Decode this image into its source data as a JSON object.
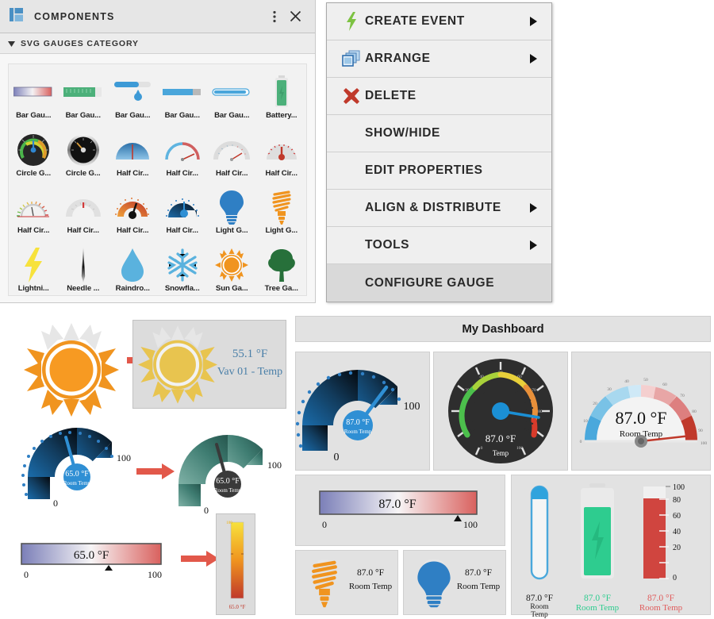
{
  "components_panel": {
    "title": "COMPONENTS",
    "icons": {
      "panel": "panel-grid-icon",
      "kebab": "more-options-icon",
      "close": "close-icon",
      "caret": "caret-down-icon"
    },
    "category": "SVG GAUGES CATEGORY",
    "items": [
      {
        "label": "Bar Gau...",
        "icon": "bar-gauge-gradient-icon"
      },
      {
        "label": "Bar Gau...",
        "icon": "bar-gauge-green-ticks-icon"
      },
      {
        "label": "Bar Gau...",
        "icon": "bar-gauge-slider-drop-icon"
      },
      {
        "label": "Bar Gau...",
        "icon": "bar-gauge-blue-fill-icon"
      },
      {
        "label": "Bar Gau...",
        "icon": "bar-gauge-rounded-icon"
      },
      {
        "label": "Battery...",
        "icon": "battery-gauge-icon"
      },
      {
        "label": "Circle G...",
        "icon": "circle-gauge-dark-icon"
      },
      {
        "label": "Circle G...",
        "icon": "circle-gauge-chrome-icon"
      },
      {
        "label": "Half Cir...",
        "icon": "half-circle-blue-dome-icon"
      },
      {
        "label": "Half Cir...",
        "icon": "half-circle-blue-red-icon"
      },
      {
        "label": "Half Cir...",
        "icon": "half-circle-grey-ticks-icon"
      },
      {
        "label": "Half Cir...",
        "icon": "half-circle-red-needle-icon"
      },
      {
        "label": "Half Cir...",
        "icon": "half-circle-color-ticks-icon"
      },
      {
        "label": "Half Cir...",
        "icon": "half-circle-grey-small-icon"
      },
      {
        "label": "Half Cir...",
        "icon": "half-circle-orange-black-icon"
      },
      {
        "label": "Half Cir...",
        "icon": "half-circle-navy-dotted-icon"
      },
      {
        "label": "Light G...",
        "icon": "light-bulb-gauge-icon"
      },
      {
        "label": "Light G...",
        "icon": "cfl-bulb-gauge-icon"
      },
      {
        "label": "Lightni...",
        "icon": "lightning-gauge-icon"
      },
      {
        "label": "Needle ...",
        "icon": "needle-gauge-icon"
      },
      {
        "label": "Raindro...",
        "icon": "raindrop-gauge-icon"
      },
      {
        "label": "Snowfla...",
        "icon": "snowflake-gauge-icon"
      },
      {
        "label": "Sun Ga...",
        "icon": "sun-gauge-icon"
      },
      {
        "label": "Tree Ga...",
        "icon": "tree-gauge-icon"
      }
    ]
  },
  "context_menu": {
    "items": [
      {
        "label": "CREATE EVENT",
        "icon": "lightning-bolt-icon",
        "submenu": true,
        "highlight": false
      },
      {
        "label": "ARRANGE",
        "icon": "arrange-windows-icon",
        "submenu": true,
        "highlight": false
      },
      {
        "label": "DELETE",
        "icon": "delete-x-icon",
        "submenu": false,
        "highlight": false
      },
      {
        "label": "SHOW/HIDE",
        "icon": "",
        "submenu": false,
        "highlight": false
      },
      {
        "label": "EDIT PROPERTIES",
        "icon": "",
        "submenu": false,
        "highlight": false
      },
      {
        "label": "ALIGN & DISTRIBUTE",
        "icon": "",
        "submenu": true,
        "highlight": false
      },
      {
        "label": "TOOLS",
        "icon": "",
        "submenu": true,
        "highlight": false
      },
      {
        "label": "CONFIGURE GAUGE",
        "icon": "",
        "submenu": false,
        "highlight": true
      }
    ]
  },
  "demo": {
    "sun_row": {
      "source_icon": "sun-gauge-icon",
      "arrow_icon": "arrow-right-icon",
      "target_icon": "sun-gauge-icon",
      "value": "55.1 °F",
      "label": "Vav 01 - Temp"
    },
    "arc_row": {
      "left_gauge": {
        "icon": "half-circle-navy-dotted-icon",
        "value": "65.0 °F",
        "label": "Room Temp",
        "min": "0",
        "max": "100"
      },
      "arrow_icon": "arrow-right-icon",
      "right_gauge": {
        "icon": "half-circle-teal-icon",
        "value": "65.0 °F",
        "label": "Room Temp",
        "min": "0",
        "max": "100"
      }
    },
    "bar_row": {
      "bar": {
        "value": "65.0 °F",
        "min": "0",
        "max": "100"
      },
      "arrow_icon": "arrow-right-icon",
      "thermo": {
        "value": "65.0 °F",
        "top_label": "100"
      }
    }
  },
  "dashboard": {
    "title": "My Dashboard",
    "cards": [
      {
        "name": "arc-gauge",
        "value": "87.0 °F",
        "label": "Room Temp",
        "min": "0",
        "max": "100"
      },
      {
        "name": "circle-gauge",
        "value": "87.0 °F",
        "label": "Temp",
        "min": "0",
        "max": "100"
      },
      {
        "name": "half-gauge",
        "value": "87.0 °F",
        "label": "Room Temp",
        "min": "0",
        "max": "100"
      }
    ],
    "bar_card": {
      "value": "87.0 °F",
      "min": "0",
      "max": "100"
    },
    "cfl_card": {
      "icon": "cfl-bulb-gauge-icon",
      "value": "87.0 °F",
      "label": "Room Temp"
    },
    "bulb_card": {
      "icon": "light-bulb-gauge-icon",
      "value": "87.0 °F",
      "label": "Room Temp"
    },
    "vertical_card": {
      "thermometer": {
        "icon": "thermometer-gauge-icon",
        "value": "87.0 °F",
        "label": "Room Temp",
        "color": "#1a1a1a"
      },
      "battery": {
        "icon": "battery-gauge-icon",
        "value": "87.0 °F",
        "label": "Room Temp",
        "color": "#2ecc8f"
      },
      "bar": {
        "icon": "vertical-bar-gauge-icon",
        "value": "87.0 °F",
        "label": "Room Temp",
        "color": "#e05c5c",
        "scale": [
          "100",
          "80",
          "60",
          "40",
          "20",
          "0"
        ]
      }
    }
  },
  "chart_data": {
    "type": "gauge-collection",
    "title": "My Dashboard",
    "gauges": [
      {
        "name": "arc-gauge",
        "value": 87.0,
        "unit": "°F",
        "label": "Room Temp",
        "min": 0,
        "max": 100
      },
      {
        "name": "circle-gauge",
        "value": 87.0,
        "unit": "°F",
        "label": "Temp",
        "min": 0,
        "max": 100
      },
      {
        "name": "half-circle-gauge",
        "value": 87.0,
        "unit": "°F",
        "label": "Room Temp",
        "min": 0,
        "max": 100
      },
      {
        "name": "horizontal-bar",
        "value": 87.0,
        "unit": "°F",
        "label": "",
        "min": 0,
        "max": 100
      },
      {
        "name": "cfl-bulb",
        "value": 87.0,
        "unit": "°F",
        "label": "Room Temp",
        "min": 0,
        "max": 100
      },
      {
        "name": "light-bulb",
        "value": 87.0,
        "unit": "°F",
        "label": "Room Temp",
        "min": 0,
        "max": 100
      },
      {
        "name": "thermometer",
        "value": 87.0,
        "unit": "°F",
        "label": "Room Temp",
        "min": 0,
        "max": 100
      },
      {
        "name": "battery",
        "value": 87.0,
        "unit": "°F",
        "label": "Room Temp",
        "min": 0,
        "max": 100
      },
      {
        "name": "vertical-bar",
        "value": 87.0,
        "unit": "°F",
        "label": "Room Temp",
        "min": 0,
        "max": 100
      },
      {
        "name": "sun-gauge",
        "value": 55.1,
        "unit": "°F",
        "label": "Vav 01 - Temp",
        "min": 0,
        "max": 100
      },
      {
        "name": "demo-arc-left",
        "value": 65.0,
        "unit": "°F",
        "label": "Room Temp",
        "min": 0,
        "max": 100
      },
      {
        "name": "demo-arc-right",
        "value": 65.0,
        "unit": "°F",
        "label": "Room Temp",
        "min": 0,
        "max": 100
      },
      {
        "name": "demo-bar",
        "value": 65.0,
        "unit": "°F",
        "label": "",
        "min": 0,
        "max": 100
      }
    ],
    "vertical_bar_ticks": [
      0,
      20,
      40,
      60,
      80,
      100
    ],
    "circle_gauge_ticks": [
      10,
      20,
      30,
      40,
      50,
      60,
      70,
      80,
      90
    ]
  },
  "colors": {
    "accent_blue": "#1b8fd4",
    "orange": "#f0941f",
    "green": "#2ecc8f",
    "red": "#e05c5c",
    "arrow_red": "#e2584a",
    "steel_blue": "#4a7fa8",
    "navy": "#0d1c2e",
    "teal": "#3f7d72"
  }
}
